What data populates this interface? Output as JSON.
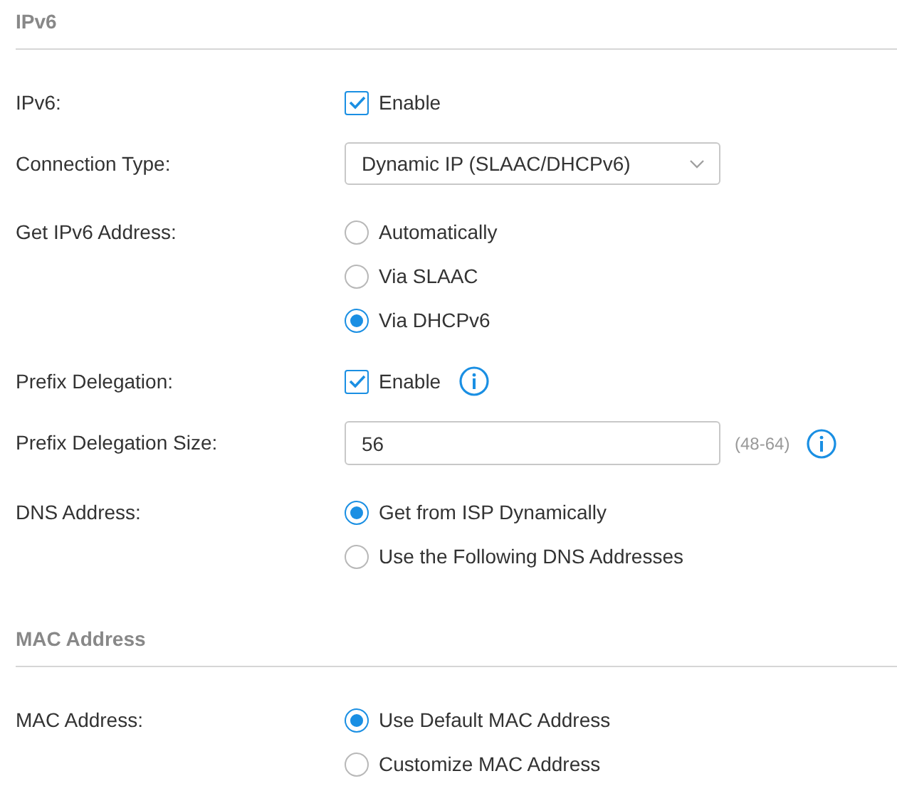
{
  "sections": [
    {
      "title": "IPv6",
      "rows": [
        {
          "kind": "checkbox",
          "label": "IPv6:",
          "option": "Enable",
          "checked": true,
          "info": false
        },
        {
          "kind": "select",
          "label": "Connection Type:",
          "value": "Dynamic IP (SLAAC/DHCPv6)"
        },
        {
          "kind": "radio",
          "label": "Get IPv6 Address:",
          "options": [
            {
              "label": "Automatically",
              "selected": false
            },
            {
              "label": "Via SLAAC",
              "selected": false
            },
            {
              "label": "Via DHCPv6",
              "selected": true
            }
          ]
        },
        {
          "kind": "checkbox",
          "label": "Prefix Delegation:",
          "option": "Enable",
          "checked": true,
          "info": true
        },
        {
          "kind": "text",
          "label": "Prefix Delegation Size:",
          "value": "56",
          "hint": "(48-64)",
          "info": true
        },
        {
          "kind": "radio",
          "label": "DNS Address:",
          "options": [
            {
              "label": "Get from ISP Dynamically",
              "selected": true
            },
            {
              "label": "Use the Following DNS Addresses",
              "selected": false
            }
          ]
        }
      ]
    },
    {
      "title": "MAC Address",
      "rows": [
        {
          "kind": "radio",
          "label": "MAC Address:",
          "options": [
            {
              "label": "Use Default MAC Address",
              "selected": true
            },
            {
              "label": "Customize MAC Address",
              "selected": false
            }
          ]
        }
      ]
    }
  ]
}
